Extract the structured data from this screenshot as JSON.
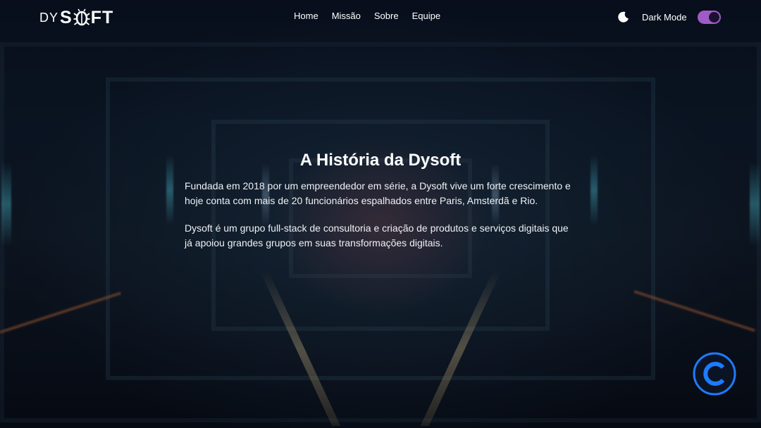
{
  "brand": {
    "logo_prefix": "DY",
    "logo_suffix": "FT"
  },
  "nav": {
    "items": [
      {
        "label": "Home"
      },
      {
        "label": "Missão"
      },
      {
        "label": "Sobre"
      },
      {
        "label": "Equipe"
      }
    ]
  },
  "theme": {
    "moon_icon": "moon-icon",
    "label": "Dark Mode",
    "toggle_on": true,
    "toggle_color": "#a05cc6"
  },
  "main": {
    "title": "A História da Dysoft",
    "paragraphs": [
      "Fundada em 2018 por um empreendedor em série, a Dysoft vive um forte crescimento e hoje conta com mais de 20 funcionários espalhados entre Paris, Amsterdã e Rio.",
      "Dysoft é um grupo full-stack de consultoria e criação de produtos e serviços digitais que já apoiou grandes grupos em suas transformações digitais."
    ]
  },
  "badge": {
    "icon": "c-logo-icon",
    "color": "#1e7bff"
  }
}
